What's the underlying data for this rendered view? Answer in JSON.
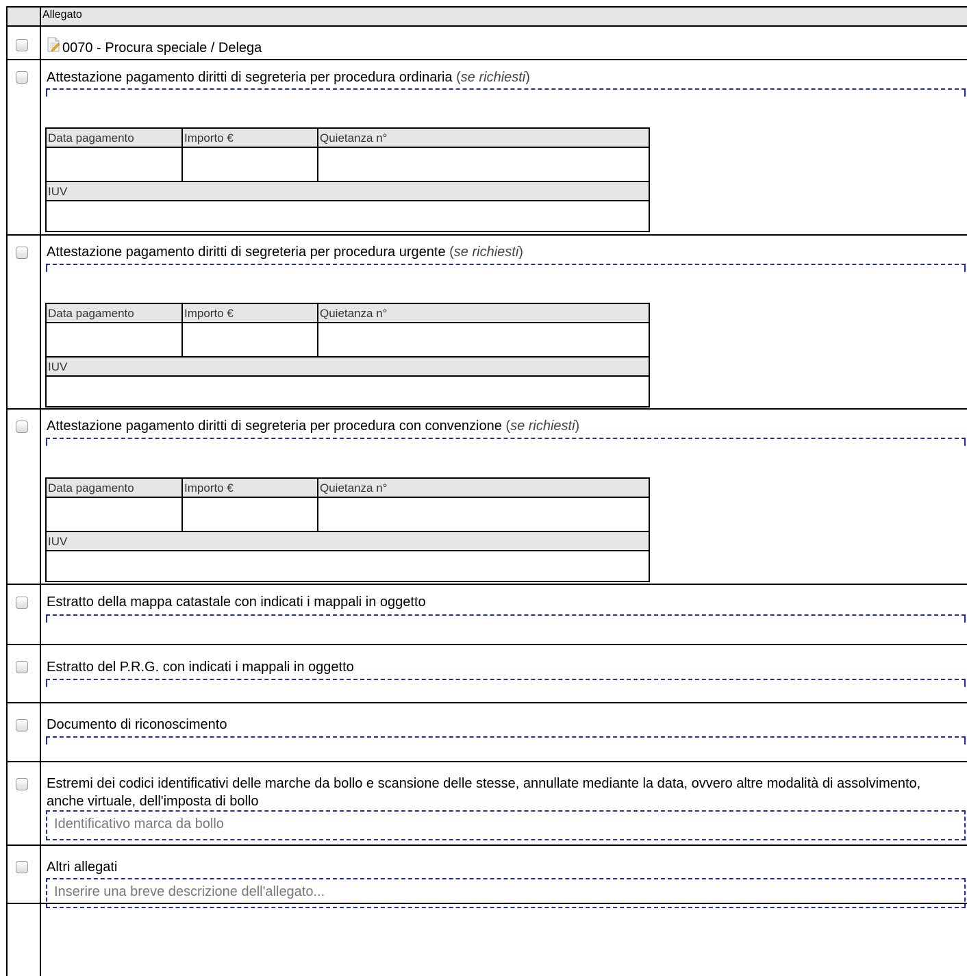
{
  "header": {
    "column_label": "Allegato"
  },
  "rows": [
    {
      "label": "0070 - Procura speciale / Delega",
      "icon": "document-edit-icon"
    },
    {
      "label": "Attestazione pagamento diritti di segreteria per procedura ordinaria",
      "note_open": " (",
      "note": "se richiesti",
      "note_close": ")",
      "payment": {
        "col1": "Data pagamento",
        "col2": "Importo €",
        "col3": "Quietanza n°",
        "col4": "IUV"
      }
    },
    {
      "label": "Attestazione pagamento diritti di segreteria per procedura urgente",
      "note_open": " (",
      "note": "se richiesti",
      "note_close": ")",
      "payment": {
        "col1": "Data pagamento",
        "col2": "Importo €",
        "col3": "Quietanza n°",
        "col4": "IUV"
      }
    },
    {
      "label": "Attestazione pagamento diritti di segreteria per procedura con convenzione",
      "note_open": " (",
      "note": "se richiesti",
      "note_close": ")",
      "payment": {
        "col1": "Data pagamento",
        "col2": "Importo €",
        "col3": "Quietanza n°",
        "col4": "IUV"
      }
    },
    {
      "label": "Estratto della mappa catastale con indicati i mappali in oggetto"
    },
    {
      "label": "Estratto del P.R.G. con indicati i mappali in oggetto"
    },
    {
      "label": "Documento di riconoscimento"
    },
    {
      "label": "Estremi dei codici identificativi delle marche da bollo e scansione delle stesse, annullate mediante la data, ovvero altre modalità di assolvimento, anche virtuale, dell'imposta di bollo",
      "input_placeholder": "Identificativo marca da bollo"
    },
    {
      "label": "Altri allegati",
      "input_placeholder": "Inserire una breve descrizione dell'allegato..."
    }
  ],
  "colors": {
    "grid": "#000000",
    "header_bg": "#e6e6e6",
    "dash": "#1f2fa6",
    "placeholder": "#777777"
  }
}
